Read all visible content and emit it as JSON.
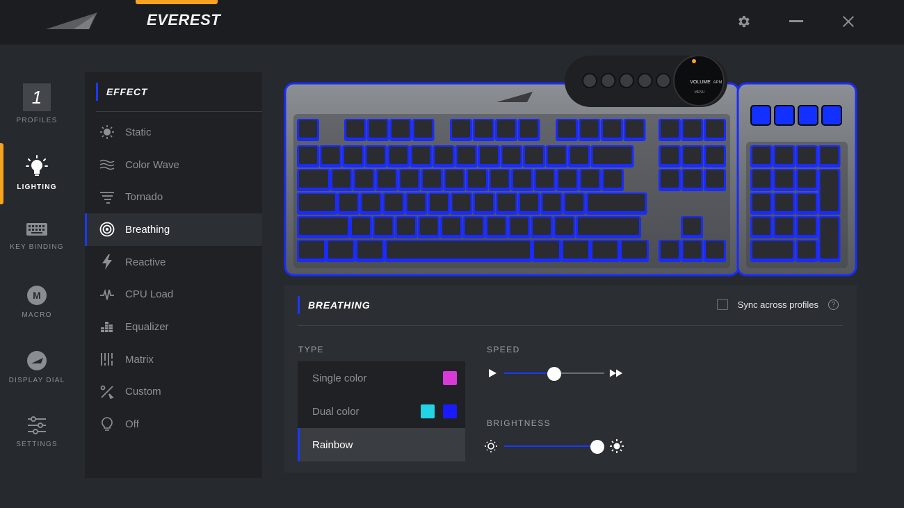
{
  "app": {
    "title": "EVEREST"
  },
  "nav": {
    "profile_number": "1",
    "items": [
      {
        "label": "PROFILES",
        "icon": "profile-icon"
      },
      {
        "label": "LIGHTING",
        "icon": "lightbulb-icon",
        "active": true
      },
      {
        "label": "KEY BINDING",
        "icon": "keyboard-icon"
      },
      {
        "label": "MACRO",
        "icon": "macro-icon",
        "badge": "M"
      },
      {
        "label": "DISPLAY DIAL",
        "icon": "display-dial-icon"
      },
      {
        "label": "SETTINGS",
        "icon": "sliders-icon"
      }
    ]
  },
  "effect": {
    "heading": "EFFECT",
    "items": [
      {
        "label": "Static",
        "icon": "sun-icon"
      },
      {
        "label": "Color Wave",
        "icon": "wave-icon"
      },
      {
        "label": "Tornado",
        "icon": "tornado-icon"
      },
      {
        "label": "Breathing",
        "icon": "breathing-icon",
        "active": true
      },
      {
        "label": "Reactive",
        "icon": "lightning-icon"
      },
      {
        "label": "CPU Load",
        "icon": "pulse-icon"
      },
      {
        "label": "Equalizer",
        "icon": "equalizer-icon"
      },
      {
        "label": "Matrix",
        "icon": "matrix-icon"
      },
      {
        "label": "Custom",
        "icon": "custom-icon"
      },
      {
        "label": "Off",
        "icon": "bulb-off-icon"
      }
    ]
  },
  "keyboard": {
    "dial_labels": {
      "volume": "VOLUME",
      "apm": "APM",
      "menu": "MENU"
    }
  },
  "breathing": {
    "heading": "BREATHING",
    "sync_label": "Sync across profiles",
    "sync_checked": false,
    "help": "?",
    "type_label": "TYPE",
    "types": [
      {
        "label": "Single color",
        "colors": [
          "#d83ad8"
        ]
      },
      {
        "label": "Dual color",
        "colors": [
          "#24d4e4",
          "#1a1aff"
        ]
      },
      {
        "label": "Rainbow",
        "active": true
      }
    ],
    "speed_label": "SPEED",
    "speed_value": 0.5,
    "brightness_label": "BRIGHTNESS",
    "brightness_value": 0.93
  },
  "colors": {
    "accent": "#1a39ff",
    "tab_accent": "#f5a320",
    "key_glow": "#1a2bff"
  }
}
